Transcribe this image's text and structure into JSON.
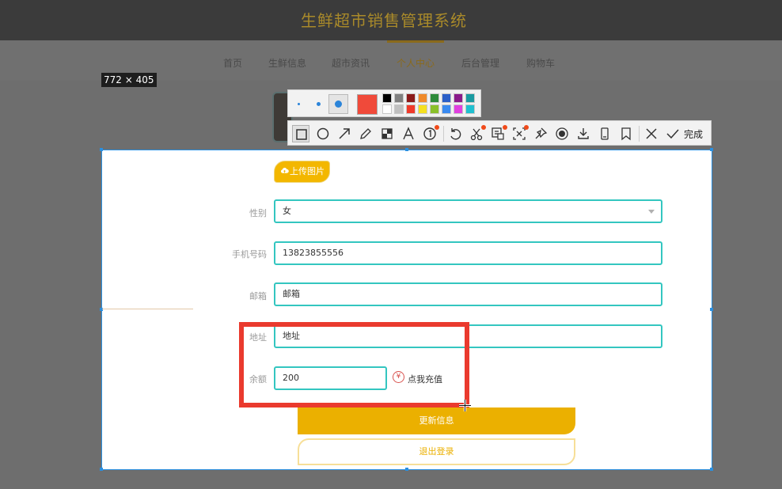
{
  "app": {
    "title": "生鲜超市销售管理系统"
  },
  "nav": {
    "items": [
      {
        "label": "首页",
        "active": false
      },
      {
        "label": "生鲜信息",
        "active": false
      },
      {
        "label": "超市资讯",
        "active": false
      },
      {
        "label": "个人中心",
        "active": true
      },
      {
        "label": "后台管理",
        "active": false
      },
      {
        "label": "购物车",
        "active": false
      }
    ]
  },
  "screenshot_tool": {
    "size_label": "772 × 405",
    "current_color": "#f04a3a",
    "palette": [
      "#000000",
      "#808080",
      "#8b1a1a",
      "#f08a2a",
      "#2e8b3a",
      "#2b5fc8",
      "#8a1a8a",
      "#1a9aa0",
      "#ffffff",
      "#c0c0c0",
      "#f03a2a",
      "#f5e020",
      "#8ac02a",
      "#3a8af0",
      "#e040e0",
      "#20c0d0"
    ],
    "tools": [
      "rectangle-tool",
      "ellipse-tool",
      "arrow-tool",
      "pencil-tool",
      "mosaic-tool",
      "text-tool",
      "number-tool",
      "undo-tool",
      "clip-tool",
      "ocr-tool",
      "translate-tool",
      "pin-tool",
      "record-tool",
      "download-tool",
      "save-mobile-tool",
      "bookmark-tool",
      "cancel-tool"
    ],
    "done_label": "完成"
  },
  "form": {
    "upload_label": "上传图片",
    "gender": {
      "label": "性别",
      "value": "女"
    },
    "phone": {
      "label": "手机号码",
      "value": "13823855556"
    },
    "email": {
      "label": "邮箱",
      "value": "邮箱"
    },
    "address": {
      "label": "地址",
      "value": "地址"
    },
    "balance": {
      "label": "余额",
      "value": "200"
    },
    "recharge_label": "点我充值",
    "update_label": "更新信息",
    "logout_label": "退出登录"
  },
  "colors": {
    "accent": "#ebb000",
    "field_border": "#33c6c0",
    "annotation": "#ea3a2e",
    "selection": "#2a8fe0"
  }
}
